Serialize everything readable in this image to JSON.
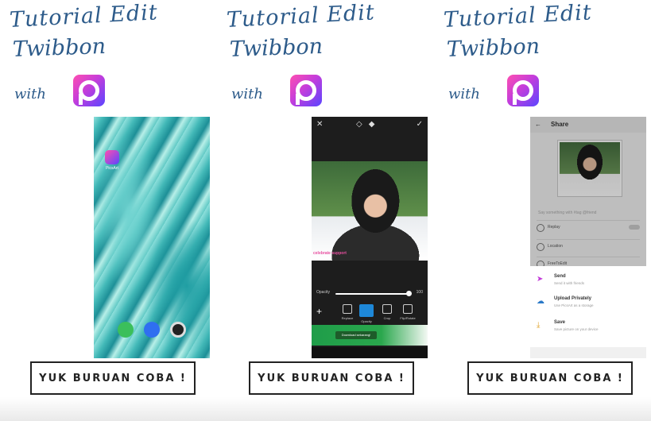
{
  "panels": [
    {
      "title_line1": "Tutorial Edit",
      "title_line2": "Twibbon",
      "title_with": "with",
      "cta_label": "YUK BURUAN COBA !",
      "screen": {
        "app_label": "PicsArt"
      }
    },
    {
      "title_line1": "Tutorial Edit",
      "title_line2": "Twibbon",
      "title_with": "with",
      "cta_label": "YUK BURUAN COBA !",
      "screen": {
        "opacity_label": "Opacity",
        "opacity_value": "100",
        "opacity_level": 1.0,
        "tools": [
          "Replace",
          "Opacity",
          "Crop",
          "Flip/Rotate"
        ],
        "banner_button": "Download sekarang!",
        "photo_tag": "celebrate support"
      }
    },
    {
      "title_line1": "Tutorial Edit",
      "title_line2": "Twibbon",
      "title_with": "with",
      "cta_label": "YUK BURUAN COBA !",
      "screen": {
        "header_title": "Share",
        "caption_placeholder": "Say something with #tag @friend",
        "rows": [
          "Replay",
          "Location",
          "FreeToEdit"
        ],
        "options": [
          {
            "name": "Send",
            "desc": "Send it with friends"
          },
          {
            "name": "Upload Privately",
            "desc": "Use PicsArt as a storage"
          },
          {
            "name": "Save",
            "desc": "Save picture on your device"
          }
        ]
      }
    }
  ],
  "colors": {
    "title": "#2d5b8a",
    "brand_pink": "#ff4fb0",
    "brand_purple": "#5a45ff",
    "accent_blue": "#1e88d8"
  }
}
